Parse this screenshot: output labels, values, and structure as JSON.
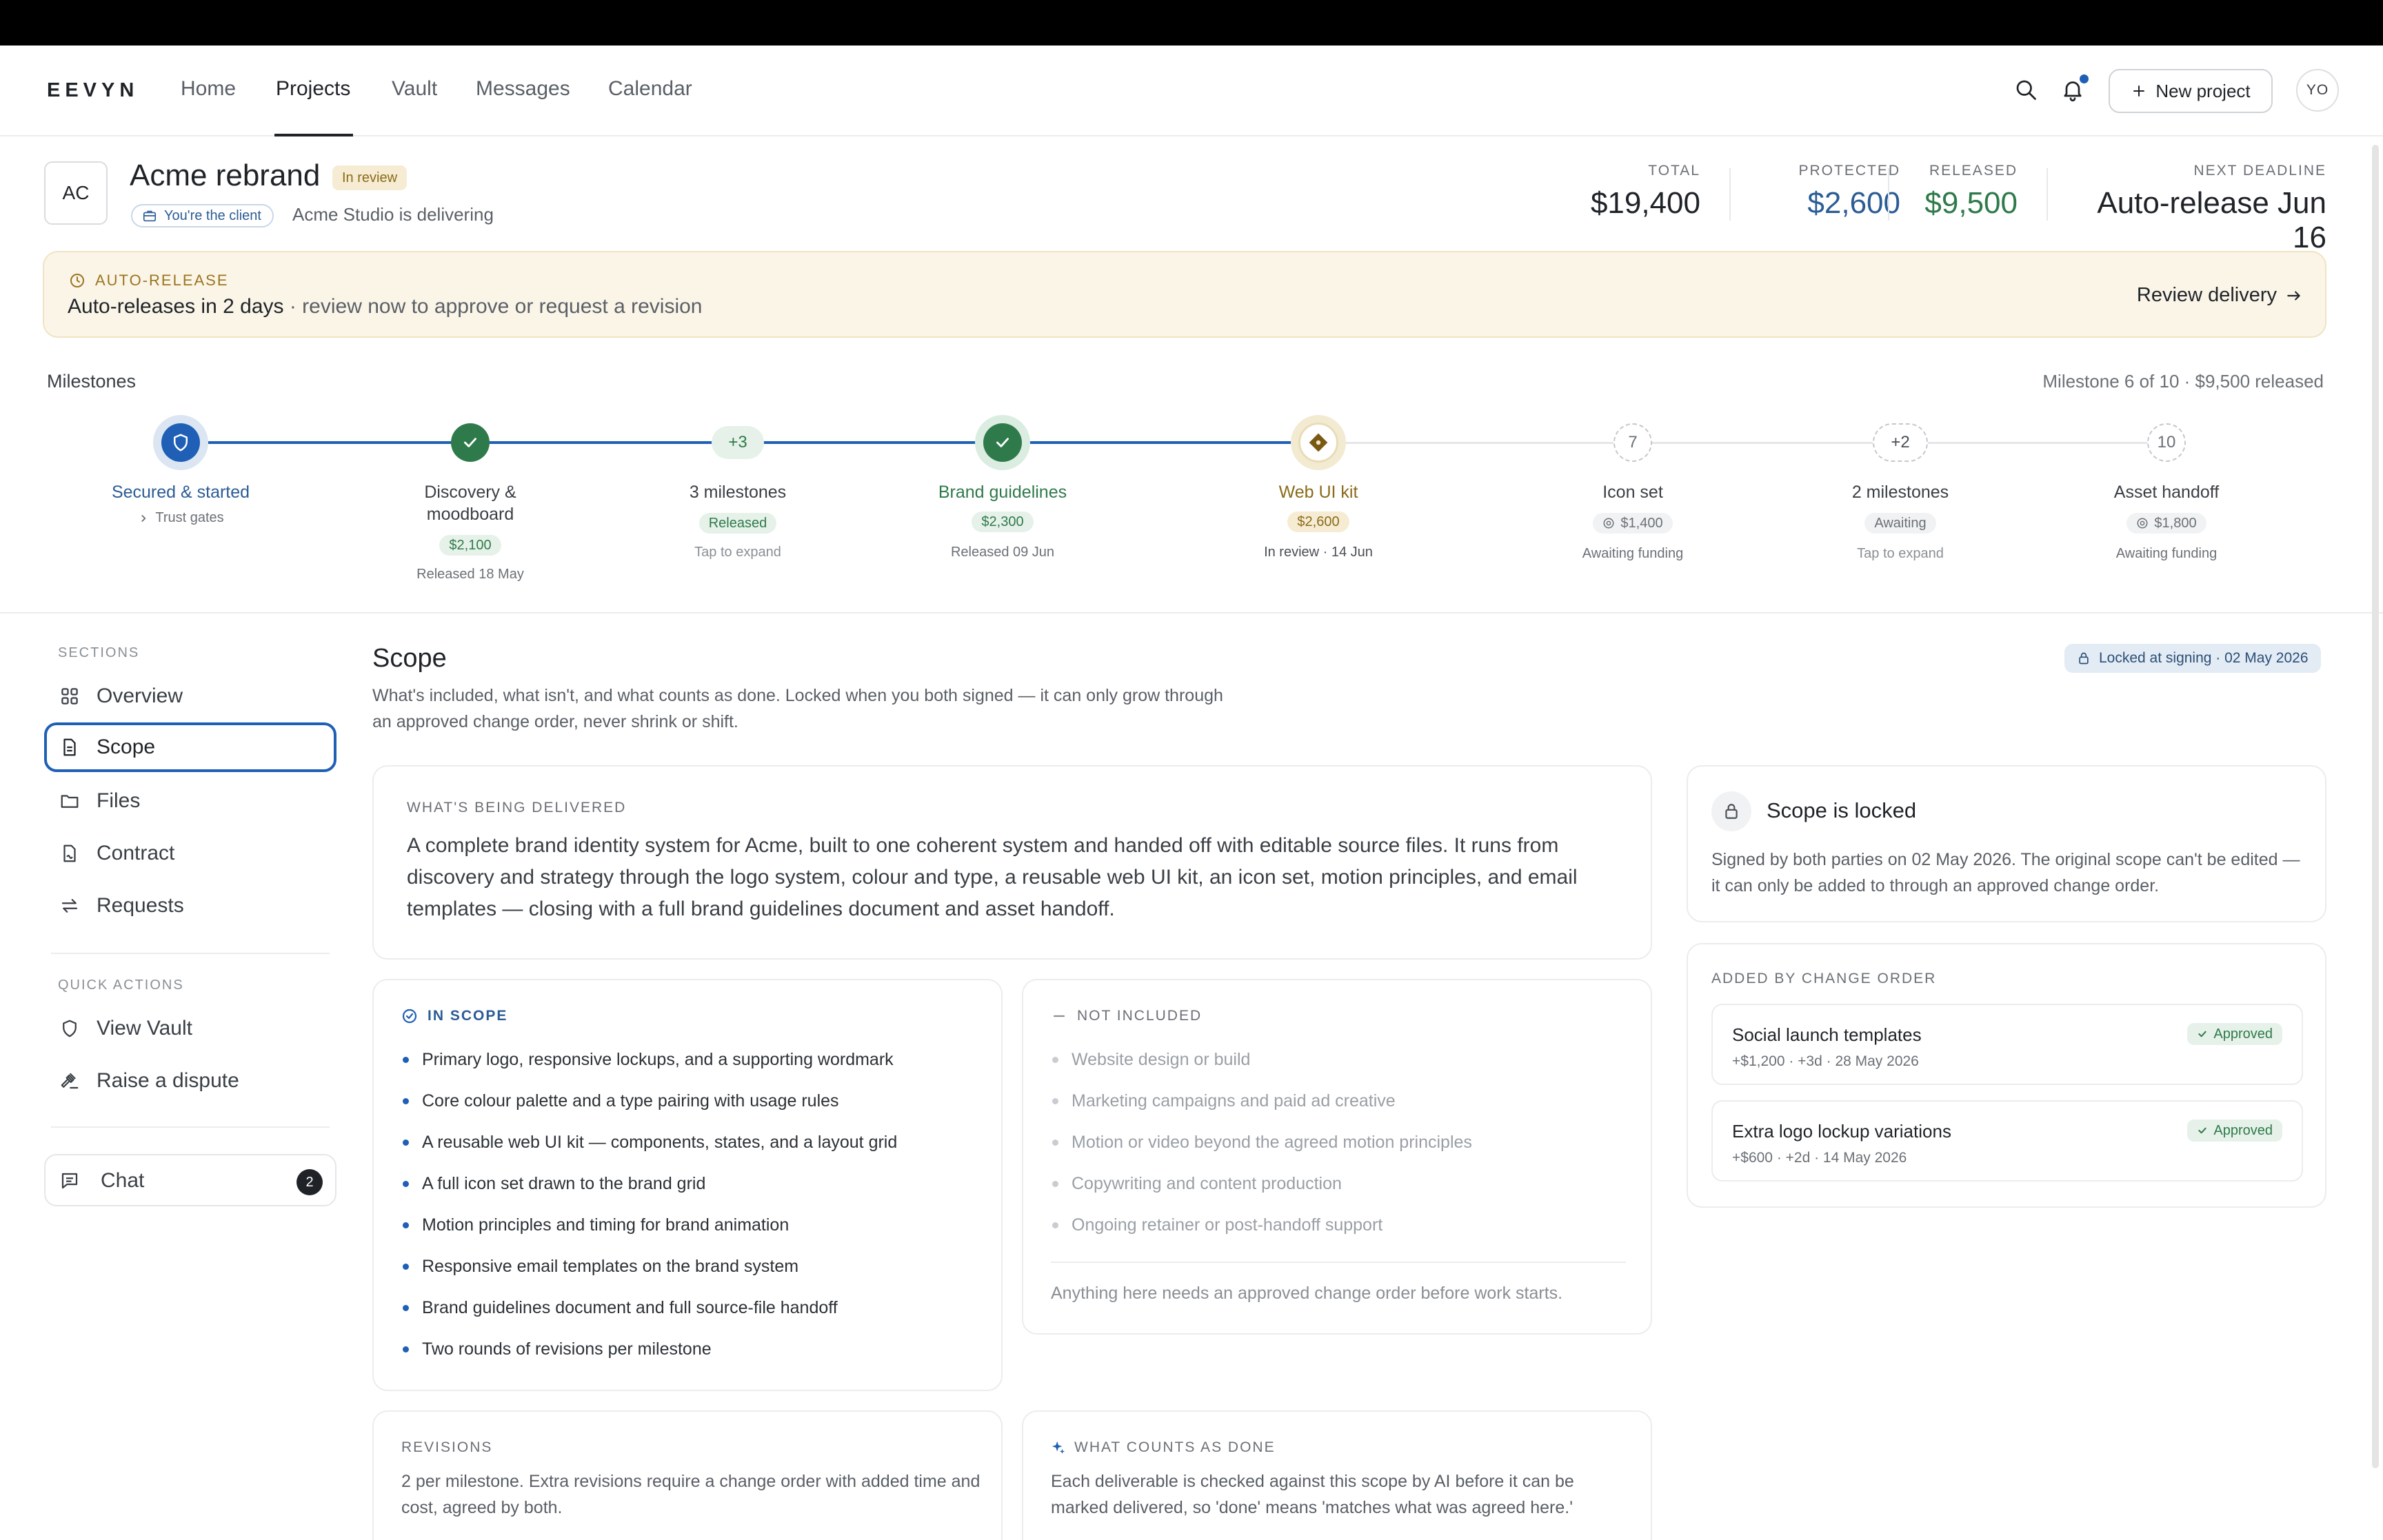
{
  "app": {
    "logo": "EEVYN",
    "new_project_label": "New project",
    "avatar_initials": "YO"
  },
  "nav": {
    "items": [
      {
        "label": "Home"
      },
      {
        "label": "Projects"
      },
      {
        "label": "Vault"
      },
      {
        "label": "Messages"
      },
      {
        "label": "Calendar"
      }
    ],
    "active": "Projects"
  },
  "project": {
    "initials": "AC",
    "title": "Acme rebrand",
    "status_badge": "In review",
    "role_pill": "You're the client",
    "delivering_text": "Acme Studio is delivering"
  },
  "stats": {
    "total": {
      "label": "TOTAL",
      "value": "$19,400"
    },
    "protected": {
      "label": "PROTECTED",
      "value": "$2,600"
    },
    "released": {
      "label": "RELEASED",
      "value": "$9,500"
    },
    "deadline": {
      "label": "NEXT DEADLINE",
      "value": "Auto-release Jun 16"
    }
  },
  "colors": {
    "accent": "#1f5fb5",
    "protected": "#2b5c95",
    "released": "#2f7a4a",
    "warning": "#9a7520"
  },
  "alert": {
    "label": "AUTO-RELEASE",
    "headline": "Auto-releases in 2 days",
    "subtext": " · review now to approve or request a revision",
    "action": "Review delivery"
  },
  "milestones": {
    "label": "Milestones",
    "summary": "Milestone 6 of 10 · $9,500 released",
    "progress_fraction": 0.56,
    "items": [
      {
        "title": "Secured & started",
        "state": "secured",
        "sub": "Trust gates"
      },
      {
        "title": "Discovery & moodboard",
        "title_line1": "Discovery &",
        "title_line2": "moodboard",
        "state": "done",
        "amount": "$2,100",
        "sub": "Released 18 May"
      },
      {
        "title": "3 milestones",
        "node": "+3",
        "state": "group-released",
        "pill": "Released",
        "sub": "Tap to expand"
      },
      {
        "title": "Brand guidelines",
        "state": "done",
        "amount": "$2,300",
        "sub": "Released 09 Jun"
      },
      {
        "title": "Web UI kit",
        "state": "in-review",
        "amount": "$2,600",
        "sub": "In review · 14 Jun"
      },
      {
        "title": "Icon set",
        "node": "7",
        "state": "awaiting",
        "amount": "$1,400",
        "sub": "Awaiting funding"
      },
      {
        "title": "2 milestones",
        "node": "+2",
        "state": "group-awaiting",
        "pill": "Awaiting",
        "sub": "Tap to expand"
      },
      {
        "title": "Asset handoff",
        "node": "10",
        "state": "awaiting",
        "amount": "$1,800",
        "sub": "Awaiting funding"
      }
    ]
  },
  "sidebar": {
    "sections_label": "SECTIONS",
    "items": [
      {
        "label": "Overview"
      },
      {
        "label": "Scope"
      },
      {
        "label": "Files"
      },
      {
        "label": "Contract"
      },
      {
        "label": "Requests"
      }
    ],
    "active": "Scope",
    "quick_label": "QUICK ACTIONS",
    "quick": [
      {
        "label": "View Vault"
      },
      {
        "label": "Raise a dispute"
      }
    ],
    "chat": {
      "label": "Chat",
      "badge": "2"
    }
  },
  "scope": {
    "title": "Scope",
    "description": "What's included, what isn't, and what counts as done. Locked when you both signed — it can only grow through an approved change order, never shrink or shift.",
    "locked_pill": "Locked at signing · 02 May 2026",
    "delivered": {
      "label": "WHAT'S BEING DELIVERED",
      "text": "A complete brand identity system for Acme, built to one coherent system and handed off with editable source files. It runs from discovery and strategy through the logo system, colour and type, a reusable web UI kit, an icon set, motion principles, and email templates — closing with a full brand guidelines document and asset handoff."
    },
    "in_scope": {
      "label": "IN SCOPE",
      "items": [
        "Primary logo, responsive lockups, and a supporting wordmark",
        "Core colour palette and a type pairing with usage rules",
        "A reusable web UI kit — components, states, and a layout grid",
        "A full icon set drawn to the brand grid",
        "Motion principles and timing for brand animation",
        "Responsive email templates on the brand system",
        "Brand guidelines document and full source-file handoff",
        "Two rounds of revisions per milestone"
      ]
    },
    "not_included": {
      "label": "NOT INCLUDED",
      "items": [
        "Website design or build",
        "Marketing campaigns and paid ad creative",
        "Motion or video beyond the agreed motion principles",
        "Copywriting and content production",
        "Ongoing retainer or post-handoff support"
      ],
      "note": "Anything here needs an approved change order before work starts."
    },
    "revisions": {
      "label": "REVISIONS",
      "text": "2 per milestone. Extra revisions require a change order with added time and cost, agreed by both."
    },
    "done": {
      "label": "WHAT COUNTS AS DONE",
      "text": "Each deliverable is checked against this scope by AI before it can be marked delivered, so 'done' means 'matches what was agreed here.'"
    },
    "locked_card": {
      "title": "Scope is locked",
      "text": "Signed by both parties on 02 May 2026. The original scope can't be edited — it can only be added to through an approved change order."
    },
    "change_orders": {
      "label": "ADDED BY CHANGE ORDER",
      "items": [
        {
          "name": "Social launch templates",
          "meta": "+$1,200 · +3d · 28 May 2026",
          "status": "Approved"
        },
        {
          "name": "Extra logo lockup variations",
          "meta": "+$600 · +2d · 14 May 2026",
          "status": "Approved"
        }
      ]
    }
  }
}
